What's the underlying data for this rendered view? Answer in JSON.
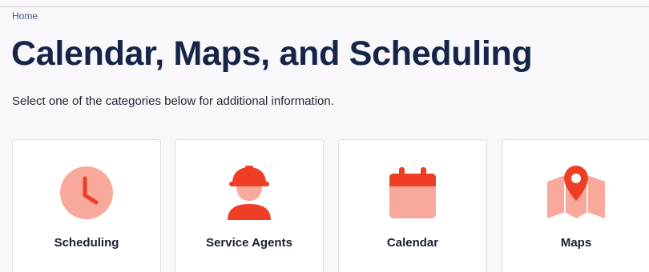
{
  "breadcrumb": {
    "home_label": "Home"
  },
  "page": {
    "title": "Calendar, Maps, and Scheduling",
    "subtitle": "Select one of the categories below for additional information."
  },
  "cards": [
    {
      "label": "Scheduling",
      "icon": "clock-icon"
    },
    {
      "label": "Service Agents",
      "icon": "worker-hardhat-icon"
    },
    {
      "label": "Calendar",
      "icon": "calendar-icon"
    },
    {
      "label": "Maps",
      "icon": "map-pin-icon"
    }
  ],
  "colors": {
    "accent_light": "#f9a99b",
    "accent_dark": "#ee3f24",
    "title": "#152447",
    "breadcrumb": "#3f5877"
  }
}
